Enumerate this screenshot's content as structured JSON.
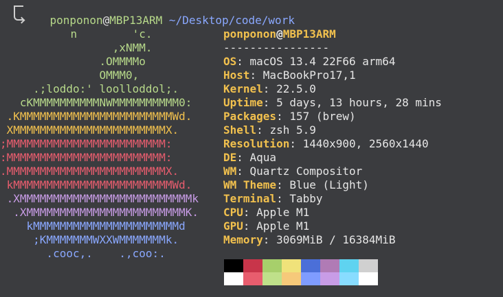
{
  "prompt": {
    "user": "ponponon",
    "at": "@",
    "host": "MBP13ARM",
    "path": " ~/Desktop/code/work",
    "command": "n"
  },
  "logo": {
    "lines": [
      {
        "text": "                    'c.",
        "color": "#b7d98a"
      },
      {
        "text": "                 ,xNMM.",
        "color": "#b7d98a"
      },
      {
        "text": "               .OMMMMo",
        "color": "#b7d98a"
      },
      {
        "text": "               OMMM0,",
        "color": "#b7d98a"
      },
      {
        "text": "     .;loddo:' loolloddol;.",
        "color": "#b7d98a"
      },
      {
        "text": "   cKMMMMMMMMMMNWMMMMMMMMMM0:",
        "color": "#b7d98a"
      },
      {
        "text": " .KMMMMMMMMMMMMMMMMMMMMMMMWd.",
        "color": "#f2c14e"
      },
      {
        "text": " XMMMMMMMMMMMMMMMMMMMMMMMX.",
        "color": "#f2c14e"
      },
      {
        "text": ";MMMMMMMMMMMMMMMMMMMMMMMM:",
        "color": "#e85d6e"
      },
      {
        "text": ":MMMMMMMMMMMMMMMMMMMMMMMM:",
        "color": "#e85d6e"
      },
      {
        "text": ".MMMMMMMMMMMMMMMMMMMMMMMMX.",
        "color": "#e85d6e"
      },
      {
        "text": " kMMMMMMMMMMMMMMMMMMMMMMMMWd.",
        "color": "#e85d6e"
      },
      {
        "text": " .XMMMMMMMMMMMMMMMMMMMMMMMMMMk",
        "color": "#c89ce6"
      },
      {
        "text": "  .XMMMMMMMMMMMMMMMMMMMMMMMMK.",
        "color": "#c89ce6"
      },
      {
        "text": "    kMMMMMMMMMMMMMMMMMMMMMMd",
        "color": "#8aa8ff"
      },
      {
        "text": "     ;KMMMMMMMWXXWMMMMMMMk.",
        "color": "#8aa8ff"
      },
      {
        "text": "       .cooc,.    .,coo:.",
        "color": "#8aa8ff"
      }
    ]
  },
  "info": {
    "user": "ponponon",
    "at": "@",
    "host": "MBP13ARM",
    "separator": "----------------",
    "rows": [
      {
        "key": "OS",
        "value": "macOS 13.4 22F66 arm64"
      },
      {
        "key": "Host",
        "value": "MacBookPro17,1"
      },
      {
        "key": "Kernel",
        "value": "22.5.0"
      },
      {
        "key": "Uptime",
        "value": "5 days, 13 hours, 28 mins"
      },
      {
        "key": "Packages",
        "value": "157 (brew)"
      },
      {
        "key": "Shell",
        "value": "zsh 5.9"
      },
      {
        "key": "Resolution",
        "value": "1440x900, 2560x1440"
      },
      {
        "key": "DE",
        "value": "Aqua"
      },
      {
        "key": "WM",
        "value": "Quartz Compositor"
      },
      {
        "key": "WM Theme",
        "value": "Blue (Light)"
      },
      {
        "key": "Terminal",
        "value": "Tabby"
      },
      {
        "key": "CPU",
        "value": "Apple M1"
      },
      {
        "key": "GPU",
        "value": "Apple M1"
      },
      {
        "key": "Memory",
        "value": "3069MiB / 16384MiB"
      }
    ]
  },
  "palette": {
    "row1": [
      "#000000",
      "#c8354a",
      "#a7cf6b",
      "#f0e27a",
      "#4b6fd8",
      "#b07bb5",
      "#5fd3f0",
      "#d0d0d0"
    ],
    "row2": [
      "#ffffff",
      "#e85d6e",
      "#bfe08a",
      "#f6c97a",
      "#7f9cff",
      "#c89ce6",
      "#88dcff",
      "#ffffff"
    ]
  }
}
